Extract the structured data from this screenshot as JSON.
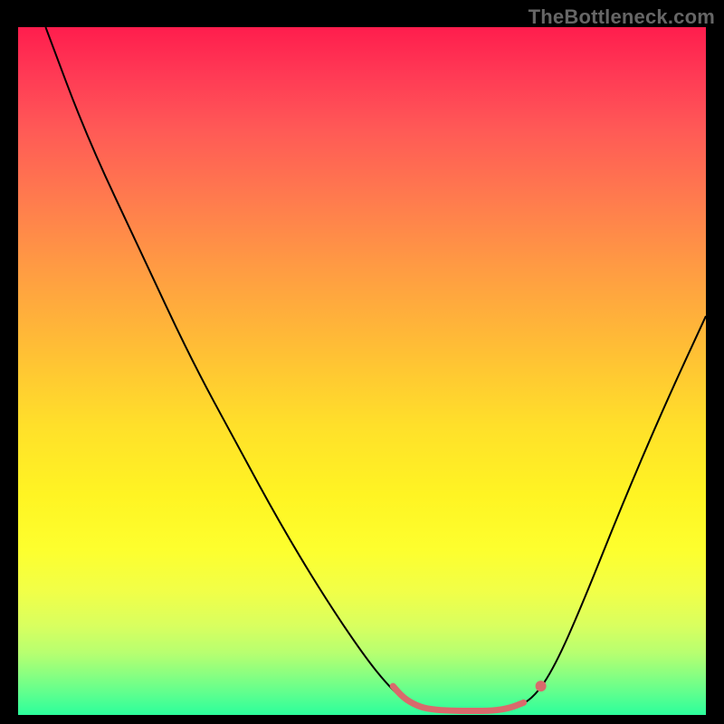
{
  "watermark": "TheBottleneck.com",
  "chart_data": {
    "type": "line",
    "title": "",
    "xlabel": "",
    "ylabel": "",
    "xlim": [
      0,
      100
    ],
    "ylim": [
      0,
      100
    ],
    "main_curve": {
      "name": "bottleneck-curve",
      "color": "#000000",
      "stroke_width": 2,
      "points": [
        {
          "x": 4,
          "y": 100
        },
        {
          "x": 10,
          "y": 84
        },
        {
          "x": 18,
          "y": 67
        },
        {
          "x": 25,
          "y": 52
        },
        {
          "x": 32,
          "y": 39
        },
        {
          "x": 38,
          "y": 28
        },
        {
          "x": 44,
          "y": 18
        },
        {
          "x": 50,
          "y": 9
        },
        {
          "x": 54,
          "y": 4
        },
        {
          "x": 57,
          "y": 1.5
        },
        {
          "x": 60,
          "y": 0.8
        },
        {
          "x": 64,
          "y": 0.6
        },
        {
          "x": 68,
          "y": 0.6
        },
        {
          "x": 72,
          "y": 0.9
        },
        {
          "x": 75,
          "y": 2.5
        },
        {
          "x": 78,
          "y": 7
        },
        {
          "x": 82,
          "y": 16
        },
        {
          "x": 88,
          "y": 31
        },
        {
          "x": 94,
          "y": 45
        },
        {
          "x": 100,
          "y": 58
        }
      ]
    },
    "accent_curve": {
      "name": "sweet-spot",
      "color": "#d96a6c",
      "stroke_width": 7,
      "points": [
        {
          "x": 54.5,
          "y": 4.2
        },
        {
          "x": 56,
          "y": 2.5
        },
        {
          "x": 58,
          "y": 1.3
        },
        {
          "x": 60,
          "y": 0.8
        },
        {
          "x": 63,
          "y": 0.6
        },
        {
          "x": 66,
          "y": 0.6
        },
        {
          "x": 69,
          "y": 0.6
        },
        {
          "x": 71.5,
          "y": 1.0
        },
        {
          "x": 73.5,
          "y": 1.8
        }
      ]
    },
    "marker": {
      "name": "marker-dot",
      "color": "#d96a6c",
      "radius": 6,
      "x": 76,
      "y": 4.2
    }
  }
}
